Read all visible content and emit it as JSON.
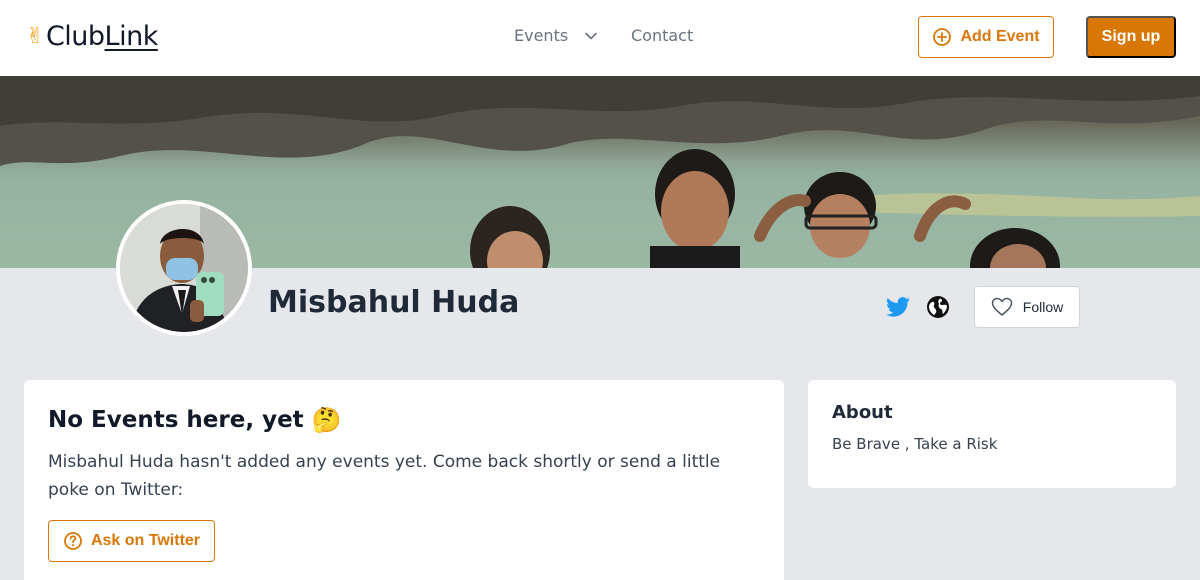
{
  "header": {
    "logo_text_club": "Club",
    "logo_text_link": "Link",
    "logo_icon": "victory-hand-icon",
    "nav": {
      "events_label": "Events",
      "contact_label": "Contact"
    },
    "add_event_label": "Add Event",
    "signup_label": "Sign up"
  },
  "profile": {
    "name": "Misbahul Huda",
    "follow_label": "Follow",
    "social_icons": [
      "twitter-icon",
      "globe-icon"
    ]
  },
  "events_card": {
    "title": "No Events here, yet",
    "title_emoji": "🤔",
    "message": "Misbahul Huda hasn't added any events yet. Come back shortly or send a little poke on Twitter:",
    "ask_button_label": "Ask on Twitter"
  },
  "about_card": {
    "title": "About",
    "text": "Be Brave , Take a Risk"
  },
  "colors": {
    "accent": "#d97706",
    "page_bg": "#e5e7eb",
    "twitter": "#1d9bf0"
  }
}
